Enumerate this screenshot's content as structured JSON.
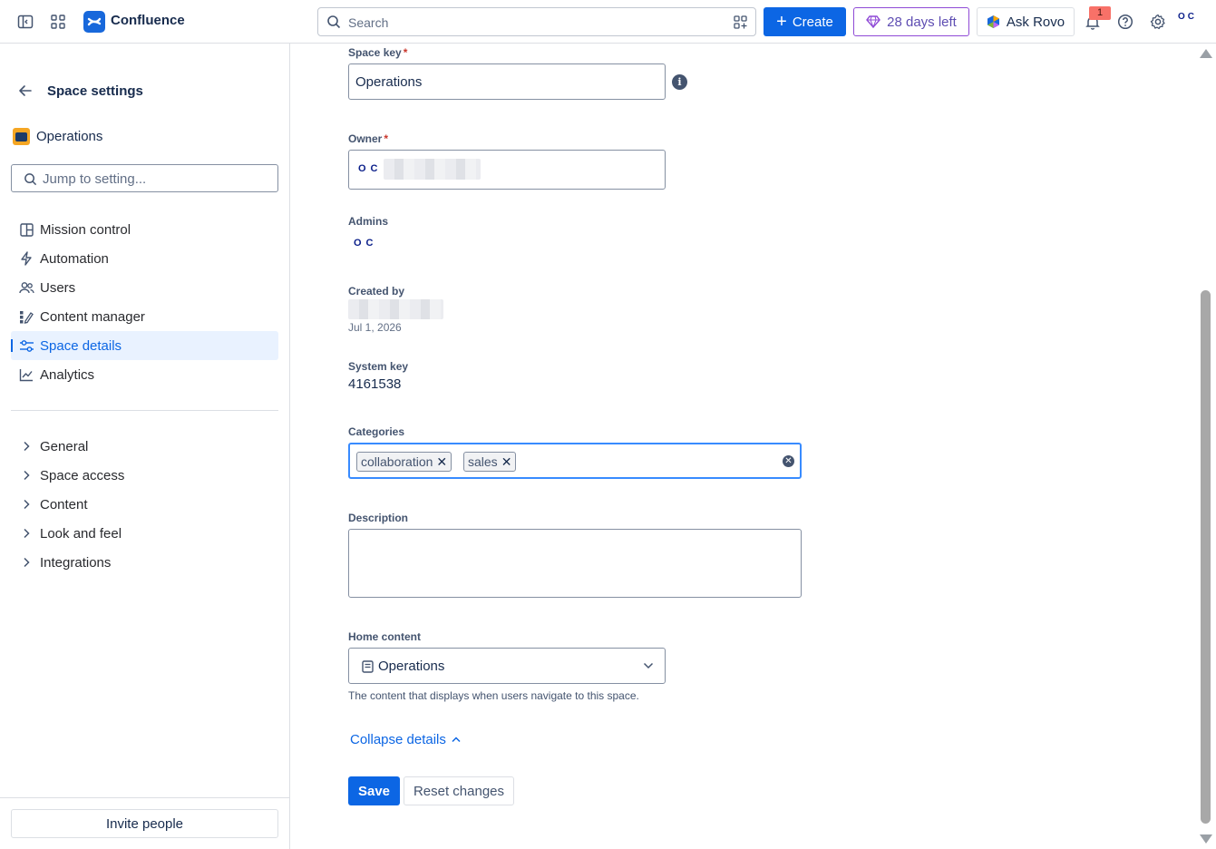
{
  "topbar": {
    "brand": "Confluence",
    "search_placeholder": "Search",
    "create_label": "Create",
    "trial_label": "28 days left",
    "rovo_label": "Ask Rovo",
    "notification_count": "1",
    "avatar_text": "OC"
  },
  "sidebar": {
    "title": "Space settings",
    "space_name": "Operations",
    "jump_placeholder": "Jump to setting...",
    "items": [
      {
        "label": "Mission control"
      },
      {
        "label": "Automation"
      },
      {
        "label": "Users"
      },
      {
        "label": "Content manager"
      },
      {
        "label": "Space details",
        "active": true
      },
      {
        "label": "Analytics"
      }
    ],
    "groups": [
      {
        "label": "General"
      },
      {
        "label": "Space access"
      },
      {
        "label": "Content"
      },
      {
        "label": "Look and feel"
      },
      {
        "label": "Integrations"
      }
    ],
    "invite_label": "Invite people"
  },
  "form": {
    "space_key_label": "Space key",
    "space_key_value": "Operations",
    "owner_label": "Owner",
    "owner_avatar": "OC",
    "admins_label": "Admins",
    "admins_avatar": "OC",
    "created_by_label": "Created by",
    "created_date": "Jul 1, 2026",
    "system_key_label": "System key",
    "system_key_value": "4161538",
    "categories_label": "Categories",
    "categories": [
      "collaboration",
      "sales"
    ],
    "description_label": "Description",
    "description_value": "",
    "home_content_label": "Home content",
    "home_content_value": "Operations",
    "home_content_help": "The content that displays when users navigate to this space.",
    "collapse_label": "Collapse details",
    "save_label": "Save",
    "reset_label": "Reset changes",
    "required_mark": "*"
  },
  "colors": {
    "primary": "#0c66e4",
    "focus_border": "#388bff",
    "required": "#c9372c",
    "trial_border": "#8f4ad6"
  }
}
